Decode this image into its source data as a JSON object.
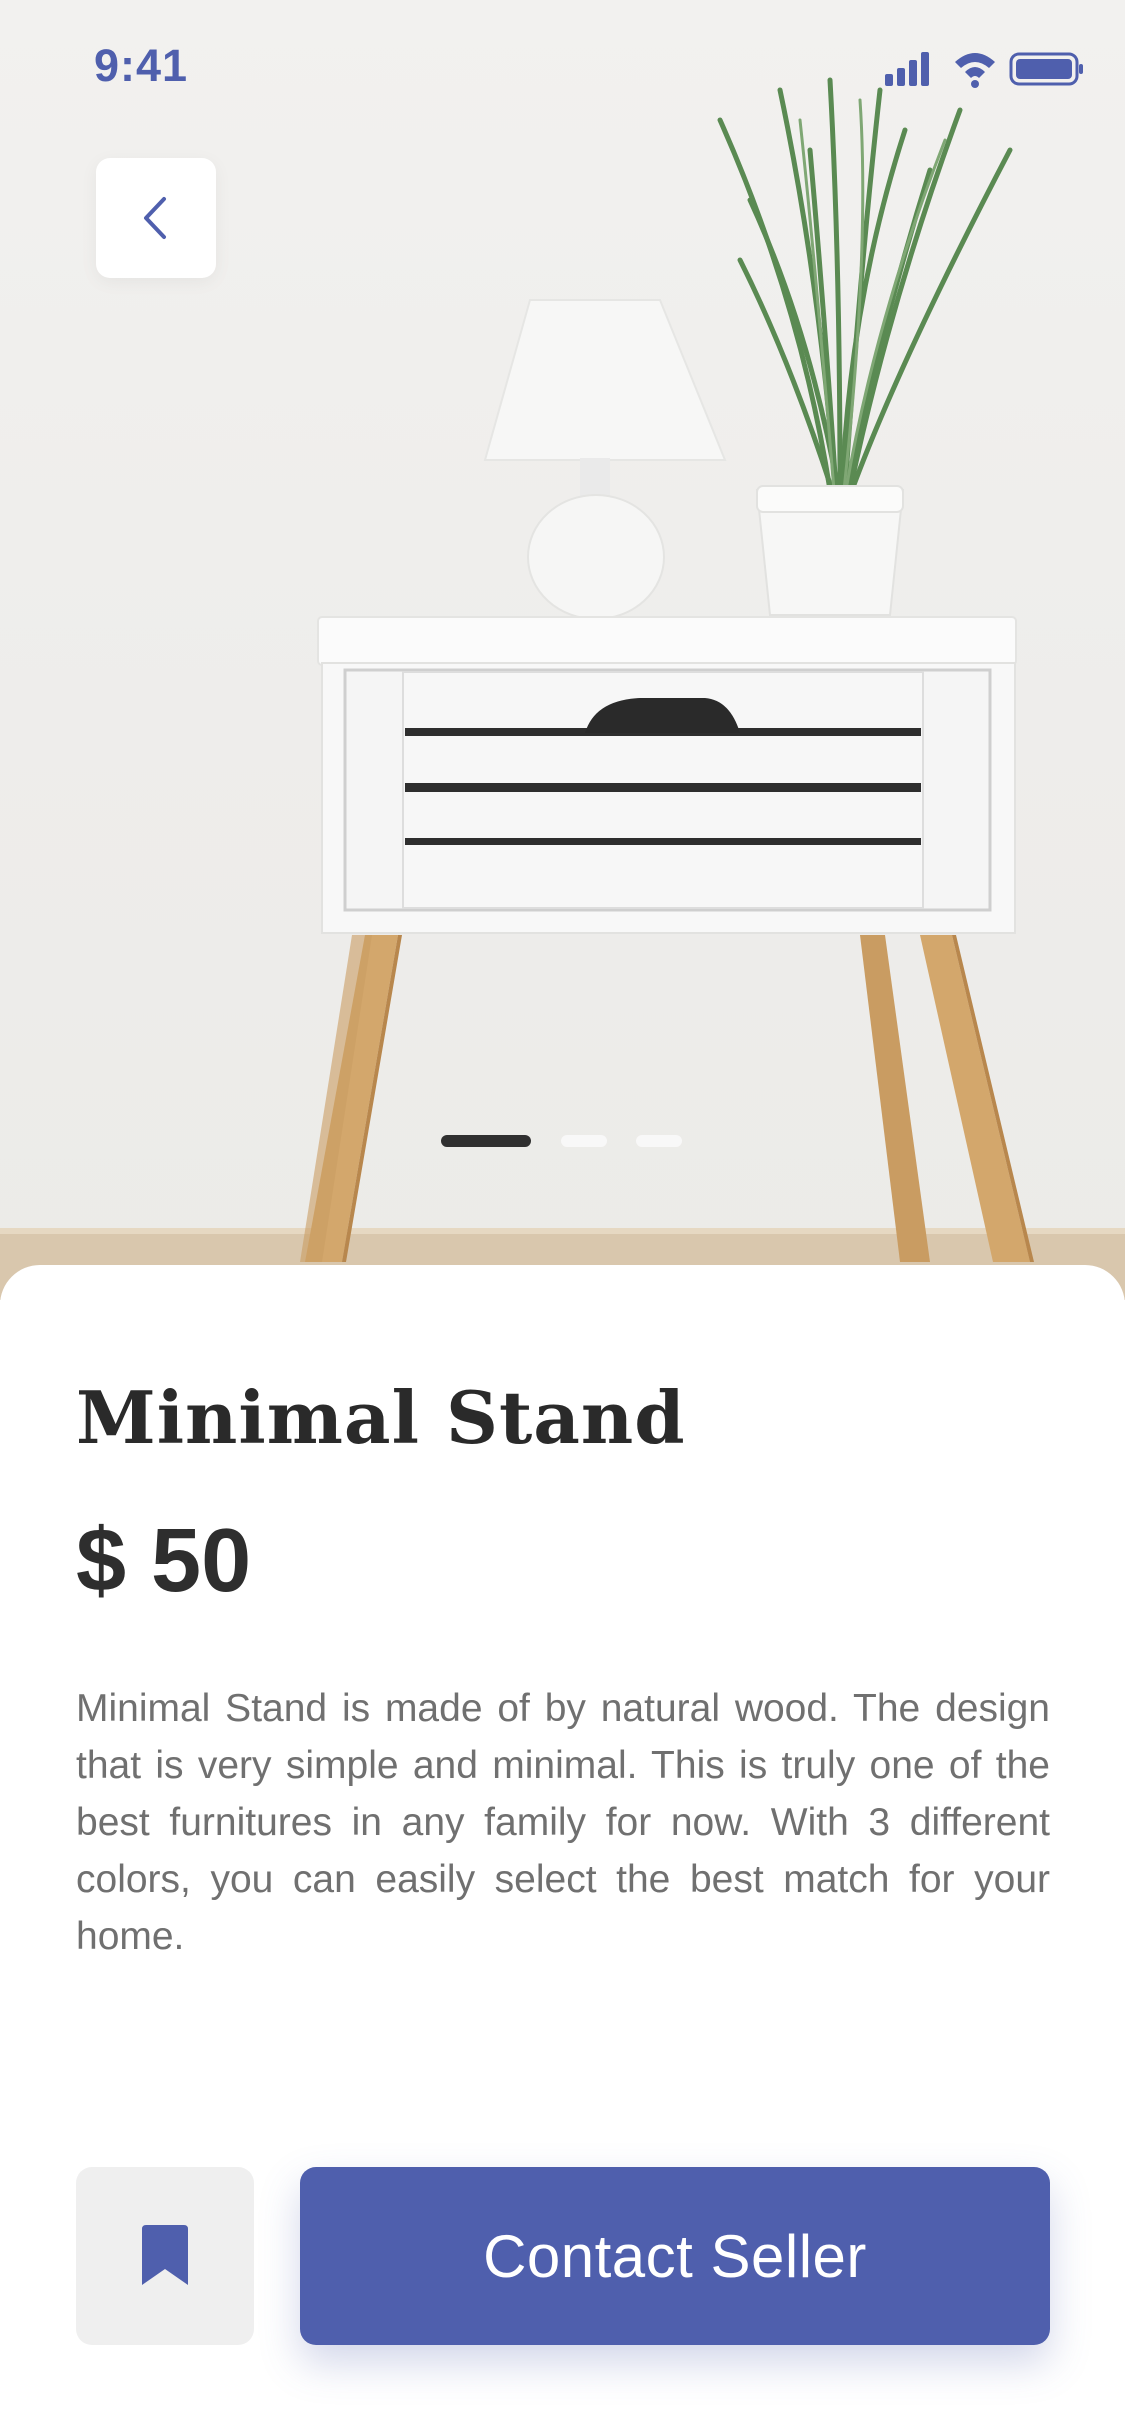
{
  "status_bar": {
    "time": "9:41",
    "icons": [
      "signal-icon",
      "wifi-icon",
      "battery-icon"
    ]
  },
  "navigation": {
    "back_icon": "chevron-left-icon"
  },
  "carousel": {
    "total_slides": 3,
    "active_index": 0
  },
  "product": {
    "name": "Minimal Stand",
    "price": "$ 50",
    "description": "Minimal Stand is made of by natural wood. The design that is very simple and minimal. This is truly one of the best furnitures in any family for now. With 3 different colors, you can easily select the best match for your home."
  },
  "actions": {
    "bookmark_icon": "bookmark-icon",
    "contact_label": "Contact Seller"
  },
  "colors": {
    "accent": "#4f5fad",
    "text_dark": "#2a2a2a",
    "text_muted": "#707070",
    "bookmark_bg": "#efefef"
  }
}
